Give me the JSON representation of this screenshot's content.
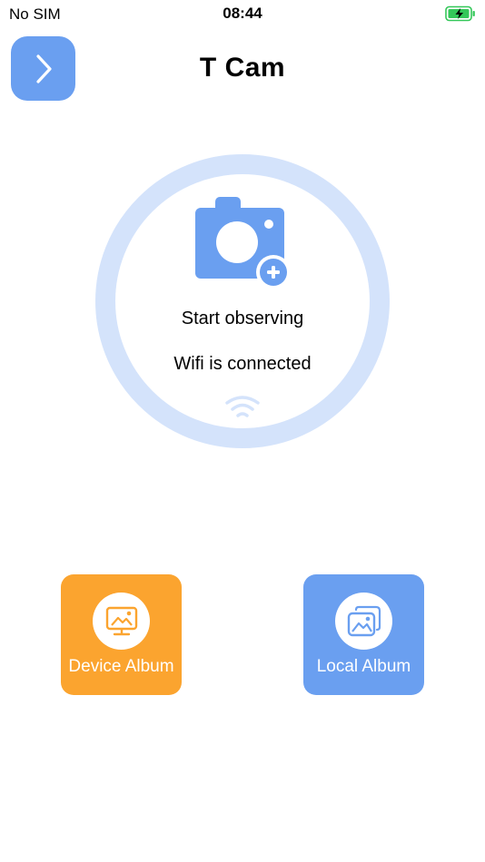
{
  "status_bar": {
    "carrier": "No SIM",
    "time": "08:44",
    "battery_icon": "battery-charging-icon"
  },
  "header": {
    "title": "T Cam",
    "back_icon": "chevron-right-icon"
  },
  "main": {
    "start_label": "Start observing",
    "wifi_status": "Wifi is connected",
    "camera_icon": "camera-add-icon",
    "wifi_icon": "wifi-icon"
  },
  "albums": {
    "device_label": "Device Album",
    "local_label": "Local Album"
  },
  "colors": {
    "accent_blue": "#6a9ff0",
    "ring_blue": "#d4e3fb",
    "orange": "#fba42f",
    "battery_green": "#34c759"
  }
}
